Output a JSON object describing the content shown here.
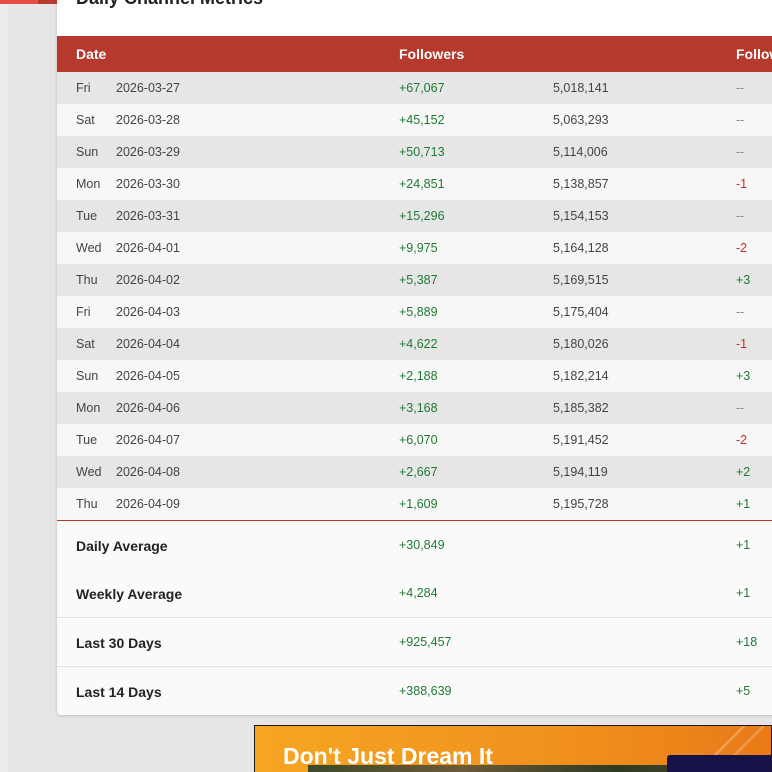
{
  "card": {
    "title": "Daily Channel Metrics"
  },
  "table": {
    "headers": {
      "date": "Date",
      "followers": "Followers",
      "following": "Follow"
    },
    "rows": [
      {
        "day": "Fri",
        "date": "2026-03-27",
        "gain": "+67,067",
        "total": "5,018,141",
        "change": "--",
        "tone": "neutral"
      },
      {
        "day": "Sat",
        "date": "2026-03-28",
        "gain": "+45,152",
        "total": "5,063,293",
        "change": "--",
        "tone": "neutral"
      },
      {
        "day": "Sun",
        "date": "2026-03-29",
        "gain": "+50,713",
        "total": "5,114,006",
        "change": "--",
        "tone": "neutral"
      },
      {
        "day": "Mon",
        "date": "2026-03-30",
        "gain": "+24,851",
        "total": "5,138,857",
        "change": "-1",
        "tone": "neg"
      },
      {
        "day": "Tue",
        "date": "2026-03-31",
        "gain": "+15,296",
        "total": "5,154,153",
        "change": "--",
        "tone": "neutral"
      },
      {
        "day": "Wed",
        "date": "2026-04-01",
        "gain": "+9,975",
        "total": "5,164,128",
        "change": "-2",
        "tone": "neg"
      },
      {
        "day": "Thu",
        "date": "2026-04-02",
        "gain": "+5,387",
        "total": "5,169,515",
        "change": "+3",
        "tone": "pos"
      },
      {
        "day": "Fri",
        "date": "2026-04-03",
        "gain": "+5,889",
        "total": "5,175,404",
        "change": "--",
        "tone": "neutral"
      },
      {
        "day": "Sat",
        "date": "2026-04-04",
        "gain": "+4,622",
        "total": "5,180,026",
        "change": "-1",
        "tone": "neg"
      },
      {
        "day": "Sun",
        "date": "2026-04-05",
        "gain": "+2,188",
        "total": "5,182,214",
        "change": "+3",
        "tone": "pos"
      },
      {
        "day": "Mon",
        "date": "2026-04-06",
        "gain": "+3,168",
        "total": "5,185,382",
        "change": "--",
        "tone": "neutral"
      },
      {
        "day": "Tue",
        "date": "2026-04-07",
        "gain": "+6,070",
        "total": "5,191,452",
        "change": "-2",
        "tone": "neg"
      },
      {
        "day": "Wed",
        "date": "2026-04-08",
        "gain": "+2,667",
        "total": "5,194,119",
        "change": "+2",
        "tone": "pos"
      },
      {
        "day": "Thu",
        "date": "2026-04-09",
        "gain": "+1,609",
        "total": "5,195,728",
        "change": "+1",
        "tone": "pos"
      }
    ]
  },
  "summary": [
    {
      "label": "Daily Average",
      "followers": "+30,849",
      "following": "+1"
    },
    {
      "label": "Weekly Average",
      "followers": "+4,284",
      "following": "+1"
    },
    {
      "label": "Last 30 Days",
      "followers": "+925,457",
      "following": "+18"
    },
    {
      "label": "Last 14 Days",
      "followers": "+388,639",
      "following": "+5"
    }
  ],
  "ad": {
    "headline": "Don't Just Dream It"
  },
  "colors": {
    "header": "#b5392c",
    "positive": "#1f7a34",
    "negative": "#c0302a",
    "neutral": "#888888",
    "ad_background": "#f0901d"
  }
}
